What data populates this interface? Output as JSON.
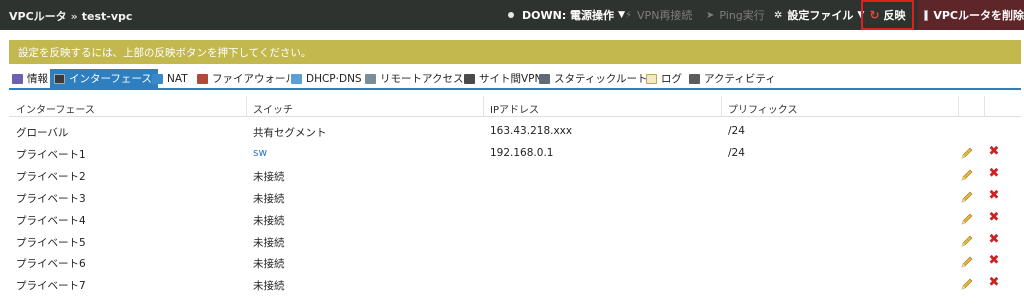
{
  "header": {
    "breadcrumb_root": "VPCルータ",
    "breadcrumb_sep": "»",
    "breadcrumb_current": "test-vpc",
    "status_label": "DOWN: 電源操作",
    "vpn_label": "VPN再接続",
    "ping_label": "Ping実行",
    "config_label": "設定ファイル",
    "apply_label": "反映",
    "delete_label": "VPCルータを削除"
  },
  "notice": {
    "text": "設定を反映するには、上部の反映ボタンを押下してください。"
  },
  "tabs": [
    {
      "label": "情報",
      "icon": "info-icon"
    },
    {
      "label": "インターフェース",
      "icon": "interface-icon",
      "active": true
    },
    {
      "label": "NAT",
      "icon": "nat-icon"
    },
    {
      "label": "ファイアウォール",
      "icon": "firewall-icon"
    },
    {
      "label": "DHCP·DNS",
      "icon": "dhcp-icon"
    },
    {
      "label": "リモートアクセス",
      "icon": "remote-access-icon"
    },
    {
      "label": "サイト間VPN",
      "icon": "site-vpn-icon"
    },
    {
      "label": "スタティックルート",
      "icon": "static-route-icon"
    },
    {
      "label": "ログ",
      "icon": "log-icon"
    },
    {
      "label": "アクティビティ",
      "icon": "activity-icon"
    }
  ],
  "table": {
    "columns": [
      "インターフェース",
      "スイッチ",
      "IPアドレス",
      "プリフィックス"
    ],
    "rows": [
      {
        "interface": "グローバル",
        "switch": "共有セグメント",
        "ip": "163.43.218.xxx",
        "prefix": "/24",
        "editable": false
      },
      {
        "interface": "プライベート1",
        "switch": "sw",
        "ip": "192.168.0.1",
        "prefix": "/24",
        "editable": true,
        "switch_link": true
      },
      {
        "interface": "プライベート2",
        "switch": "未接続",
        "ip": "",
        "prefix": "",
        "editable": true
      },
      {
        "interface": "プライベート3",
        "switch": "未接続",
        "ip": "",
        "prefix": "",
        "editable": true
      },
      {
        "interface": "プライベート4",
        "switch": "未接続",
        "ip": "",
        "prefix": "",
        "editable": true
      },
      {
        "interface": "プライベート5",
        "switch": "未接続",
        "ip": "",
        "prefix": "",
        "editable": true
      },
      {
        "interface": "プライベート6",
        "switch": "未接続",
        "ip": "",
        "prefix": "",
        "editable": true
      },
      {
        "interface": "プライベート7",
        "switch": "未接続",
        "ip": "",
        "prefix": "",
        "editable": true
      }
    ]
  },
  "colors": {
    "topbar": "#2f332f",
    "notice": "#c2b84d",
    "accent": "#2e7fc0",
    "apply_highlight": "#e02020",
    "delete_bg": "#5e2628"
  }
}
